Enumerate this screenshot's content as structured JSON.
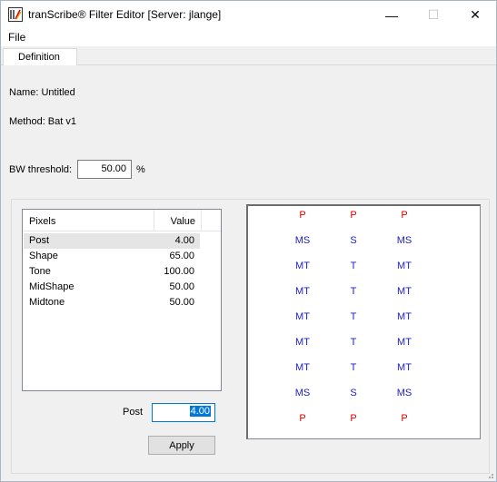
{
  "window": {
    "title": "tranScribe® Filter Editor  [Server: jlange]",
    "minimize_glyph": "—",
    "maximize_glyph": "☐",
    "close_glyph": "✕"
  },
  "menu": {
    "file": "File"
  },
  "tabs": [
    {
      "label": "Definition"
    }
  ],
  "form": {
    "name_label": "Name: Untitled",
    "method_label": "Method: Bat v1",
    "bw_label": "BW threshold:",
    "bw_value": "50.00",
    "bw_unit": "%"
  },
  "list": {
    "headers": {
      "name": "Pixels",
      "value": "Value"
    },
    "rows": [
      {
        "name": "Post",
        "value": "4.00"
      },
      {
        "name": "Shape",
        "value": "65.00"
      },
      {
        "name": "Tone",
        "value": "100.00"
      },
      {
        "name": "MidShape",
        "value": "50.00"
      },
      {
        "name": "Midtone",
        "value": "50.00"
      }
    ],
    "selected_index": 0
  },
  "editor": {
    "field_label": "Post",
    "field_value": "4.00",
    "apply_label": "Apply"
  },
  "grid": {
    "rows": [
      [
        "P",
        "P",
        "P"
      ],
      [
        "MS",
        "S",
        "MS"
      ],
      [
        "MT",
        "T",
        "MT"
      ],
      [
        "MT",
        "T",
        "MT"
      ],
      [
        "MT",
        "T",
        "MT"
      ],
      [
        "MT",
        "T",
        "MT"
      ],
      [
        "MT",
        "T",
        "MT"
      ],
      [
        "MS",
        "S",
        "MS"
      ],
      [
        "P",
        "P",
        "P"
      ]
    ],
    "row_colors": [
      "#e00000",
      "#2020c0",
      "#2020c0",
      "#2020c0",
      "#2020c0",
      "#2020c0",
      "#2020c0",
      "#2020c0",
      "#e00000"
    ]
  },
  "icons": {
    "app": "app-icon",
    "minimize": "minimize-icon",
    "maximize": "maximize-icon",
    "close": "close-icon"
  }
}
